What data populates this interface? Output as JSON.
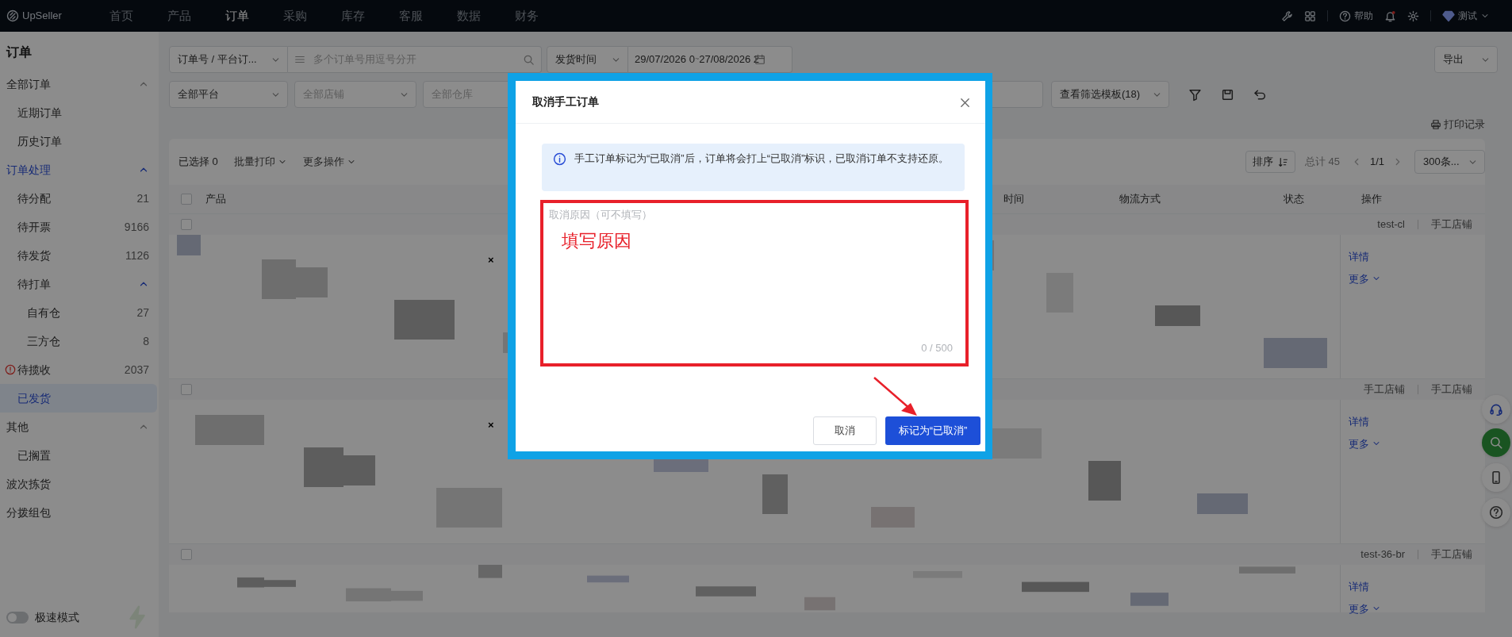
{
  "top_nav": {
    "logo": "UpSeller",
    "items": [
      {
        "label": "首页",
        "selected": false
      },
      {
        "label": "产品",
        "selected": false
      },
      {
        "label": "订单",
        "selected": true
      },
      {
        "label": "采购",
        "selected": false
      },
      {
        "label": "库存",
        "selected": false
      },
      {
        "label": "客服",
        "selected": false
      },
      {
        "label": "数据",
        "selected": false
      },
      {
        "label": "财务",
        "selected": false
      }
    ],
    "help": "帮助",
    "user": "测试"
  },
  "sidebar": {
    "title": "订单",
    "items": [
      {
        "label": "全部订单",
        "expanded": true,
        "selected": false,
        "children": [
          {
            "label": "近期订单",
            "selected": false
          },
          {
            "label": "历史订单",
            "selected": false
          }
        ]
      },
      {
        "label": "订单处理",
        "expanded": true,
        "selected": false,
        "children": [
          {
            "label": "待分配",
            "count": "21",
            "selected": false
          },
          {
            "label": "待开票",
            "count": "9166",
            "selected": false
          },
          {
            "label": "待发货",
            "count": "1126",
            "selected": false
          },
          {
            "label": "待打单",
            "expanded": true,
            "selected": false,
            "children": [
              {
                "label": "自有仓",
                "count": "27",
                "selected": false
              },
              {
                "label": "三方仓",
                "count": "8",
                "selected": false
              }
            ]
          },
          {
            "label": "待揽收",
            "count": "2037",
            "warning": true,
            "selected": false
          },
          {
            "label": "已发货",
            "selected": true
          }
        ]
      },
      {
        "label": "其他",
        "expanded": true,
        "selected": false,
        "children": [
          {
            "label": "已搁置",
            "selected": false
          }
        ]
      },
      {
        "label": "波次拣货",
        "selected": false
      },
      {
        "label": "分拨组包",
        "selected": false
      }
    ],
    "speed_mode": {
      "label": "极速模式",
      "on": false
    }
  },
  "filters": {
    "search_type": "订单号 / 平台订...",
    "search_placeholder": "多个订单号用逗号分开",
    "time_type": "发货时间",
    "date_start": "29/07/2026 0",
    "date_sep": "~",
    "date_end": "27/08/2026 2",
    "export": "导出",
    "platform": "全部平台",
    "shop_placeholder": "全部店铺",
    "warehouse_placeholder": "全部仓库",
    "template": "查看筛选模板(18)"
  },
  "print_log": "打印记录",
  "table": {
    "selected_count": "已选择 0",
    "actions": [
      "批量打印",
      "更多操作"
    ],
    "sort": "排序",
    "total": "总计 45",
    "page": "1/1",
    "page_size": "300条...",
    "header_checked": false,
    "columns": [
      {
        "label": "产品"
      },
      {
        "label": "时间"
      },
      {
        "label": "物流方式"
      },
      {
        "label": "状态"
      },
      {
        "label": "操作"
      }
    ],
    "rows": [
      {
        "checked": false,
        "shop": "test-cl",
        "store_type": "手工店铺",
        "mark": "×",
        "actions": [
          "详情",
          "更多"
        ]
      },
      {
        "checked": false,
        "shop": "手工店铺",
        "store_type": "手工店铺",
        "mark": "×",
        "actions": [
          "详情",
          "更多"
        ]
      },
      {
        "checked": false,
        "shop": "test-36-br",
        "store_type": "手工店铺",
        "actions": [
          "详情",
          "更多"
        ]
      }
    ]
  },
  "modal": {
    "title": "取消手工订单",
    "notice": "手工订单标记为“已取消”后，订单将会打上“已取消”标识，已取消订单不支持还原。",
    "reason_placeholder": "取消原因（可不填写）",
    "counter": "0 / 500",
    "annotation": "填写原因",
    "cancel": "取消",
    "confirm": "标记为“已取消”"
  }
}
